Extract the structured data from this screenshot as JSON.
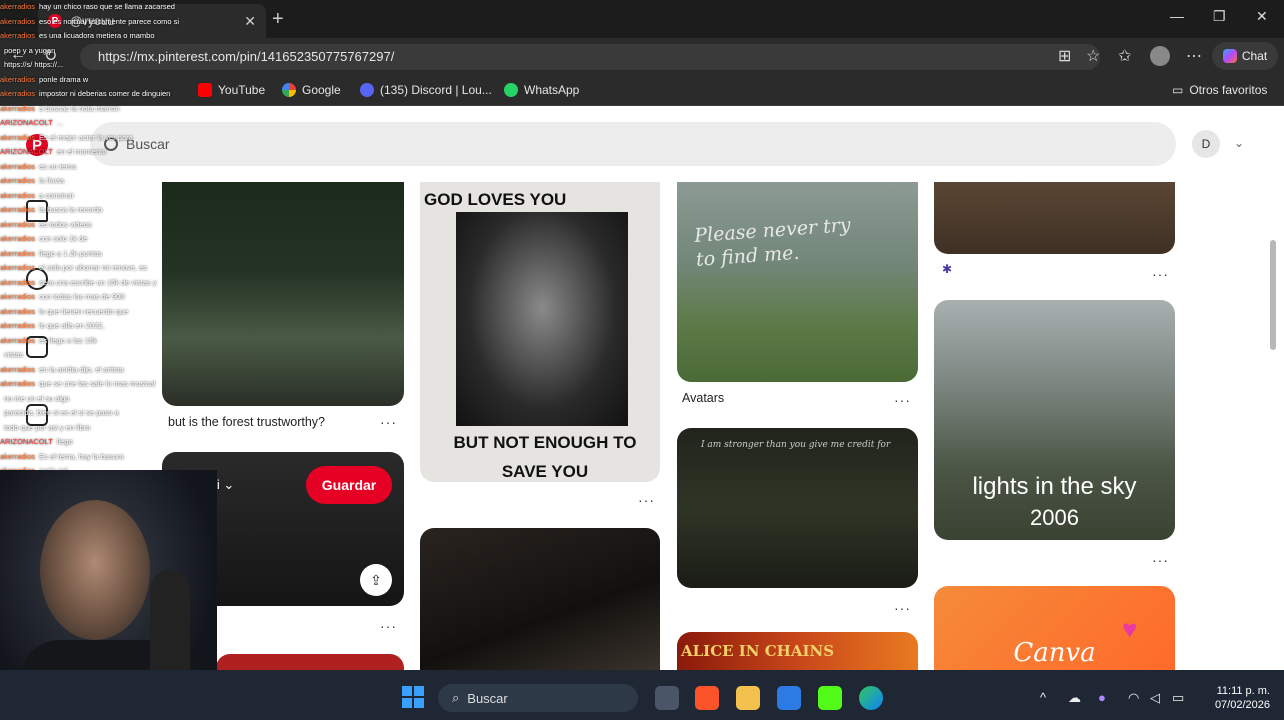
{
  "browser": {
    "tab_title": "@vyouu",
    "url": "https://mx.pinterest.com/pin/141652350775767297/",
    "chat_button": "Chat",
    "bookmarks": [
      {
        "label": "YouTube",
        "color": "#ff0000"
      },
      {
        "label": "Google",
        "color": "#4285f4"
      },
      {
        "label": "(135) Discord | Lou...",
        "color": "#5865f2"
      },
      {
        "label": "WhatsApp",
        "color": "#25d366"
      }
    ],
    "other_favorites": "Otros favoritos"
  },
  "pinterest": {
    "search_placeholder": "Buscar",
    "profile_initial": "D",
    "pins": {
      "forest_caption": "but is the forest trustworthy?",
      "god_top": "GOD LOVES YOU",
      "god_bottom": "BUT NOT ENOUGH TO SAVE YOU",
      "please_text": "Please never try to find me.",
      "avatars_caption": "Avatars",
      "stronger_text": "I am stronger than you give me credit for",
      "alice_text": "ALICE IN CHAINS",
      "lights_text_1": "lights in the sky",
      "lights_text_2": "2006",
      "canva_text": "Canva",
      "save_button": "Guardar",
      "board_select": "ii"
    },
    "dots": "···"
  },
  "chat_overlay": {
    "lines": [
      {
        "user": "akerradios",
        "text": "hay un chico raso que se llama zacarsed"
      },
      {
        "user": "akerradios",
        "text": "eso es normal fisicamente parece como si"
      },
      {
        "user": "akerradios",
        "text": "es una licuadora metiera o mambo"
      },
      {
        "user": "",
        "text": "poep y a yugan"
      },
      {
        "user": "",
        "text": "https://s/ https://..."
      },
      {
        "user": "akerradios",
        "text": "ponle drama w"
      },
      {
        "user": "akerradios",
        "text": "impostor ni deberias comer de dinguien"
      },
      {
        "user": "akerradios",
        "text": "a buscas la nota marron"
      },
      {
        "user": "ARIZONACOLT",
        "text": "..."
      },
      {
        "user": "akerradios",
        "text": "Es el mejor actor la ver para"
      },
      {
        "user": "ARIZONACOLT",
        "text": "en el momento"
      },
      {
        "user": "akerradios",
        "text": "es un tema"
      },
      {
        "user": "akerradios",
        "text": "la lluvia"
      },
      {
        "user": "akerradios",
        "text": "a construir"
      },
      {
        "user": "akerradios",
        "text": "la busca la recordo"
      },
      {
        "user": "akerradios",
        "text": "eo todos videos"
      },
      {
        "user": "akerradios",
        "text": "con solo 1k de"
      },
      {
        "user": "akerradios",
        "text": "llego a 1.2k puntos"
      },
      {
        "user": "akerradios",
        "text": "el solo por ahorrar mi renove, es"
      },
      {
        "user": "akerradios",
        "text": "sera una escribe un 15k de vistas y"
      },
      {
        "user": "akerradios",
        "text": "con todas los mas de 900"
      },
      {
        "user": "akerradios",
        "text": "lo que tienen recuerdo que"
      },
      {
        "user": "akerradios",
        "text": "lo que alla en 2022,"
      },
      {
        "user": "akerradios",
        "text": "es llego a las 15k"
      },
      {
        "user": "",
        "text": "vistas"
      },
      {
        "user": "akerradios",
        "text": "en la anidia dijo, el artista"
      },
      {
        "user": "akerradios",
        "text": "que se une las sale lo mas musical"
      },
      {
        "user": "",
        "text": "no me un el su algo"
      },
      {
        "user": "",
        "text": "parecida, bien si es el si se paso a"
      },
      {
        "user": "",
        "text": "todo que por asi y en libro"
      },
      {
        "user": "ARIZONACOLT",
        "text": "llego"
      },
      {
        "user": "akerradios",
        "text": "Es el tema, hay la basura"
      },
      {
        "user": "akerradios",
        "text": "parla sal"
      }
    ]
  },
  "taskbar": {
    "search": "Buscar",
    "time": "11:11 p. m.",
    "date": "07/02/2026"
  }
}
